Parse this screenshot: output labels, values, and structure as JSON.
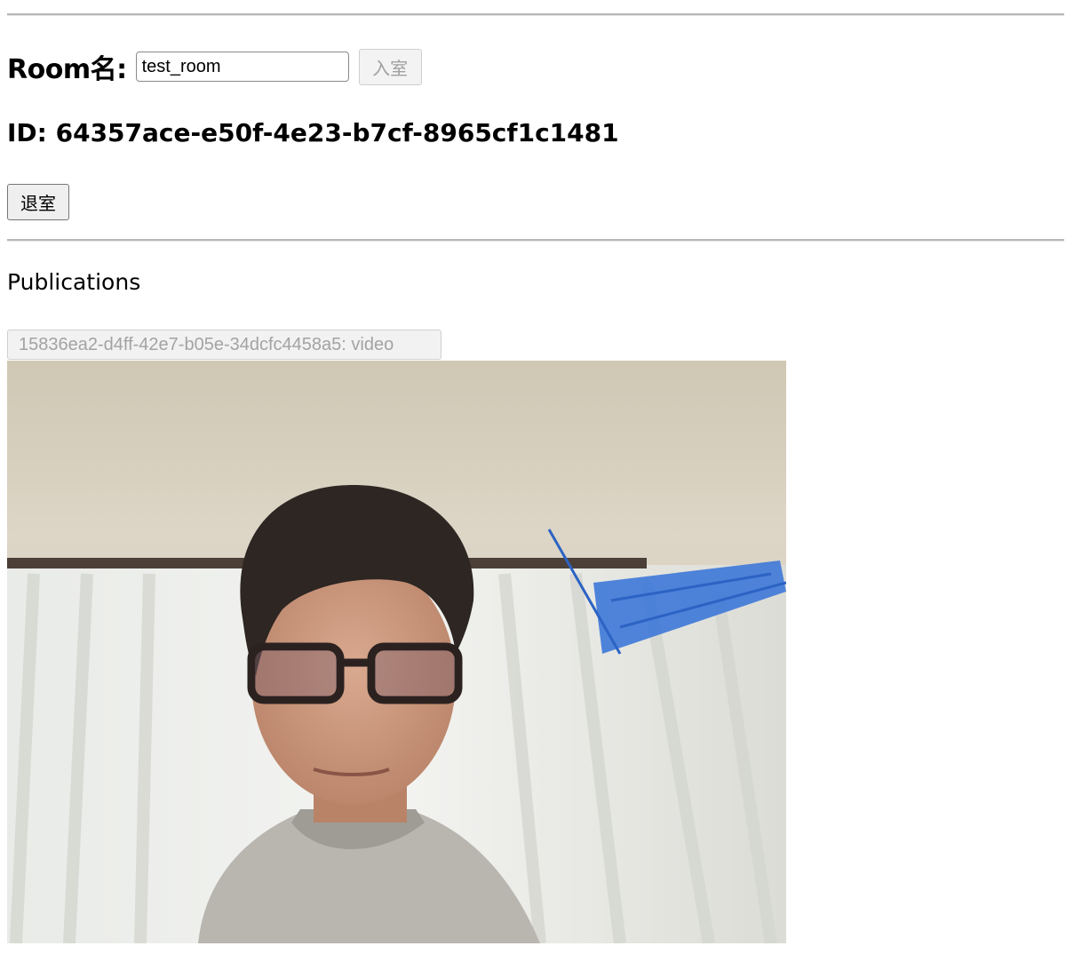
{
  "room": {
    "label": "Room名:",
    "input_value": "test_room",
    "join_label": "入室"
  },
  "id_line": "ID: 64357ace-e50f-4e23-b7cf-8965cf1c1481",
  "leave_label": "退室",
  "publications": {
    "heading": "Publications",
    "items": [
      {
        "label": "15836ea2-d4ff-42e7-b05e-34dcfc4458a5: video"
      }
    ]
  }
}
